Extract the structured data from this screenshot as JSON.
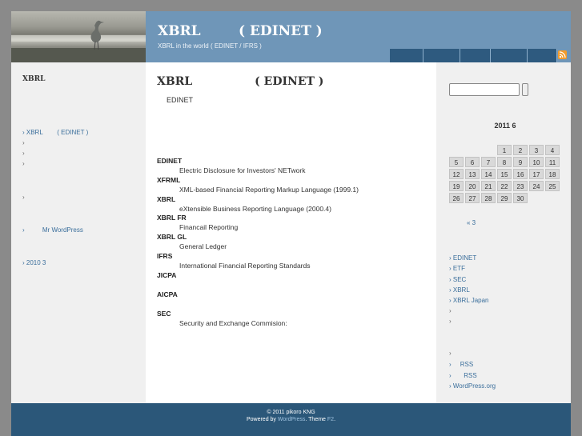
{
  "header": {
    "title": "XBRL        ( EDINET )",
    "description": "XBRL in the world ( EDINET / IFRS )"
  },
  "left_sidebar": {
    "heading": "XBRL",
    "items": [
      "› XBRL        ( EDINET )",
      "›",
      "›",
      "›",
      "›",
      "›          Mr WordPress",
      "› 2010 3"
    ]
  },
  "post": {
    "title": "XBRL                ( EDINET )",
    "intro": "EDINET",
    "terms": [
      {
        "term": "EDINET",
        "definition": "Electric Disclosure for Investors' NETwork"
      },
      {
        "term": "XFRML",
        "definition": "XML-based Financial Reporting Markup Language (1999.1)"
      },
      {
        "term": "XBRL",
        "definition": "eXtensible Business Reporting Language (2000.4)"
      },
      {
        "term": "XBRL FR",
        "definition": "Financail Reporting"
      },
      {
        "term": "XBRL GL",
        "definition": "General Ledger"
      },
      {
        "term": "IFRS",
        "definition": "International Financial Reporting Standards"
      },
      {
        "term": "JICPA",
        "definition": ""
      },
      {
        "term": "AICPA",
        "definition": ""
      },
      {
        "term": "SEC",
        "definition": "Security and Exchange Commision:"
      }
    ]
  },
  "right_sidebar": {
    "calendar": {
      "caption": "2011  6",
      "days": [
        "",
        "",
        "",
        "1",
        "2",
        "3",
        "4",
        "5",
        "6",
        "7",
        "8",
        "9",
        "10",
        "11",
        "12",
        "13",
        "14",
        "15",
        "16",
        "17",
        "18",
        "19",
        "20",
        "21",
        "22",
        "23",
        "24",
        "25",
        "26",
        "27",
        "28",
        "29",
        "30",
        "",
        ""
      ],
      "prev_link": "« 3"
    },
    "links": [
      "› EDINET",
      "› ETF",
      "› SEC",
      "› XBRL",
      "› XBRL Japan",
      "›",
      "›",
      "›",
      "›     RSS",
      "›       RSS",
      "› WordPress.org"
    ]
  },
  "footer": {
    "line1": "© 2011 pikoro KNG",
    "powered_prefix": "Powered by ",
    "powered_link": "WordPress",
    "theme_text": ". Theme ",
    "theme_link": "F2",
    "suffix": "."
  },
  "colors": {
    "header_bg": "#6f96b8",
    "nav_bg": "#2e5a7f",
    "footer_bg": "#2b5779",
    "link": "#3a6e9b"
  }
}
